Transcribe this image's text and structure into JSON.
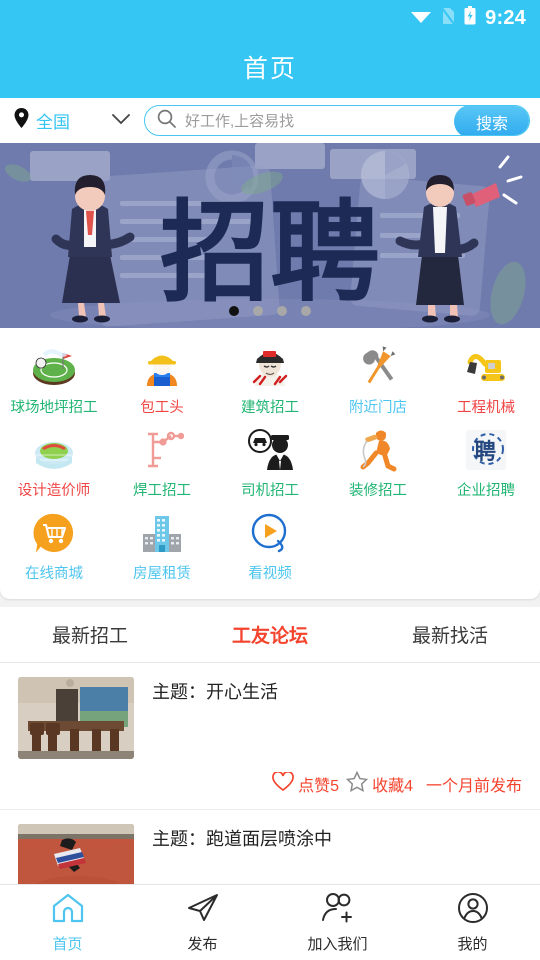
{
  "status_bar": {
    "time": "9:24",
    "wifi_icon": "wifi-icon",
    "sim_icon": "sim-off-icon",
    "battery_icon": "battery-charging-icon"
  },
  "header": {
    "title": "首页"
  },
  "search": {
    "location_label": "全国",
    "location_pin_icon": "location-pin-icon",
    "chevron_icon": "chevron-down-icon",
    "search_icon": "search-icon",
    "placeholder": "好工作,上容易找",
    "button_label": "搜索"
  },
  "banner": {
    "headline": "招聘",
    "dots_total": 4,
    "active_dot": 1
  },
  "grid": {
    "rows": [
      [
        {
          "label": "球场地坪招工",
          "color": "#22b573",
          "icon": "sports-field-icon"
        },
        {
          "label": "包工头",
          "color": "#f04545",
          "icon": "foreman-helmet-icon"
        },
        {
          "label": "建筑招工",
          "color": "#22b573",
          "icon": "construction-worker-icon"
        },
        {
          "label": "附近门店",
          "color": "#4ec5ef",
          "icon": "tools-wrench-plier-icon"
        },
        {
          "label": "工程机械",
          "color": "#f04545",
          "icon": "excavator-icon"
        }
      ],
      [
        {
          "label": "设计造价师",
          "color": "#f04545",
          "icon": "stadium-design-icon"
        },
        {
          "label": "焊工招工",
          "color": "#22b573",
          "icon": "robotic-arm-icon"
        },
        {
          "label": "司机招工",
          "color": "#22b573",
          "icon": "driver-icon"
        },
        {
          "label": "装修招工",
          "color": "#22b573",
          "icon": "decorator-spray-icon"
        },
        {
          "label": "企业招聘",
          "color": "#22b573",
          "icon": "enterprise-hire-icon"
        }
      ],
      [
        {
          "label": "在线商城",
          "color": "#4ec5ef",
          "icon": "shopping-cart-icon"
        },
        {
          "label": "房屋租赁",
          "color": "#4ec5ef",
          "icon": "building-rent-icon"
        },
        {
          "label": "看视频",
          "color": "#4ec5ef",
          "icon": "play-video-icon"
        }
      ]
    ]
  },
  "tabs": [
    {
      "label": "最新招工",
      "active": false
    },
    {
      "label": "工友论坛",
      "active": true
    },
    {
      "label": "最新找活",
      "active": false
    }
  ],
  "posts": [
    {
      "title": "主题：开心生活",
      "thumb": "living-room-furniture-photo",
      "like_icon": "heart-icon",
      "like_label": "点赞5",
      "fav_icon": "star-icon",
      "fav_label": "收藏4",
      "time_label": "一个月前发布",
      "has_meta": true
    },
    {
      "title": "主题：跑道面层喷涂中",
      "thumb": "running-track-spray-photo",
      "has_meta": false
    }
  ],
  "bottom_nav": [
    {
      "label": "首页",
      "icon": "home-icon",
      "active": true
    },
    {
      "label": "发布",
      "icon": "paper-plane-icon",
      "active": false
    },
    {
      "label": "加入我们",
      "icon": "add-people-icon",
      "active": false
    },
    {
      "label": "我的",
      "icon": "user-circle-icon",
      "active": false
    }
  ],
  "colors": {
    "brand": "#35c6f4",
    "accent_red": "#f4442e",
    "green": "#22b573"
  }
}
